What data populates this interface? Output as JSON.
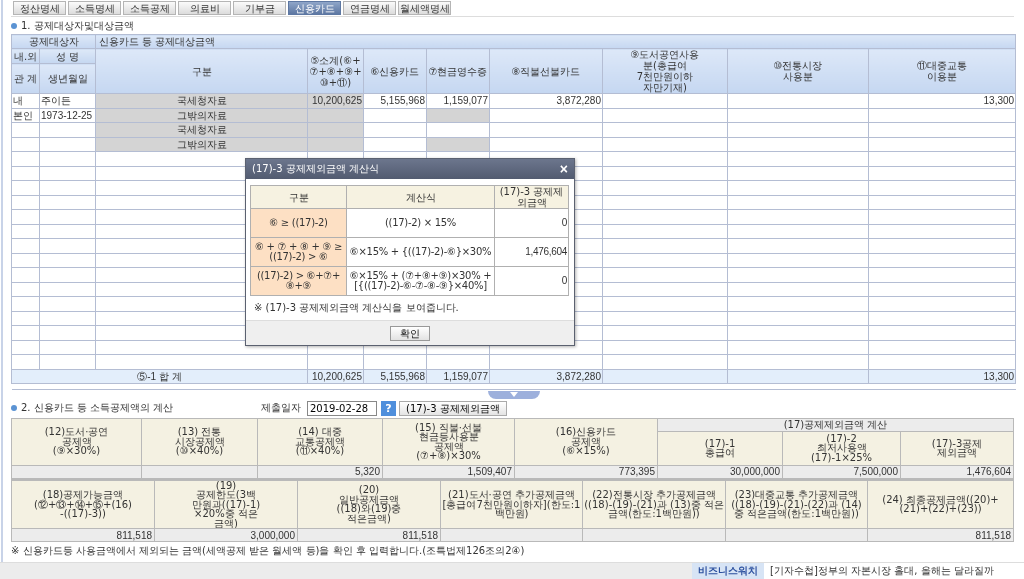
{
  "tabs": [
    {
      "label": "정산명세",
      "selected": false
    },
    {
      "label": "소득명세",
      "selected": false
    },
    {
      "label": "소득공제",
      "selected": false
    },
    {
      "label": "의료비",
      "selected": false
    },
    {
      "label": "기부금",
      "selected": false
    },
    {
      "label": "신용카드",
      "selected": true
    },
    {
      "label": "연금명세",
      "selected": false
    },
    {
      "label": "월세액명세",
      "selected": false
    }
  ],
  "section1": {
    "title": "1. 공제대상자및대상금액",
    "group_person": "공제대상자",
    "group_amounts": "신용카드 등 공제대상금액",
    "person_header_top": [
      "내.외",
      "성    명"
    ],
    "person_header_bottom": [
      "관 계",
      "생년월일"
    ],
    "columns": [
      "구분",
      "⑤소계(⑥+\n⑦+⑧+⑨+\n⑩+⑪)",
      "⑥신용카드",
      "⑦현금영수증",
      "⑧직불선불카드",
      "⑨도서공연사용\n분(총급여\n7천만원이하\n자만기재)",
      "⑩전통시장\n사용분",
      "⑪대중교통\n이용분"
    ],
    "rows": [
      {
        "kind": "nts",
        "person": [
          "내",
          "주이든"
        ],
        "category": "국세청자료",
        "values": {
          "subtotal": "10,200,625",
          "credit_card": "5,155,968",
          "cash_receipt": "1,159,077",
          "debit_card": "3,872,280",
          "public_transport": "13,300"
        }
      },
      {
        "kind": "other",
        "person": [
          "본인",
          "1973-12-25"
        ],
        "category": "그밖의자료"
      },
      {
        "kind": "nts",
        "category": "국세청자료"
      },
      {
        "kind": "other",
        "category": "그밖의자료"
      }
    ],
    "total": {
      "label": "⑤-1 합   계",
      "values": {
        "subtotal": "10,200,625",
        "credit_card": "5,155,968",
        "cash_receipt": "1,159,077",
        "debit_card": "3,872,280",
        "public_transport": "13,300"
      }
    }
  },
  "section2": {
    "title": "2. 신용카드 등 소득공제액의 계산",
    "date_label": "제출일자",
    "date_value": "2019-02-28",
    "help_button": "?",
    "exclusion_button": "(17)-3 공제제외금액",
    "headers_top": [
      "(12)도서·공연\n공제액\n(⑨×30%)",
      "(13) 전통\n시장공제액\n(⑩×40%)",
      "(14) 대중\n교통공제액\n(⑪×40%)",
      "(15) 직불·선불\n현금등사용분\n공제액\n(⑦+⑧)×30%",
      "(16)신용카드\n공제액\n(⑥×15%)"
    ],
    "exclusion_group": "(17)공제제외금액  계산",
    "exclusion_headers": [
      "(17)-1\n총급여",
      "(17)-2\n최저사용액\n(17)-1×25%",
      "(17)-3공제\n제외금액"
    ],
    "values_top": {
      "item_14": "5,320",
      "item_15": "1,509,407",
      "item_16": "773,395",
      "item_17_1": "30,000,000",
      "item_17_2": "7,500,000",
      "item_17_3": "1,476,604"
    },
    "headers_bottom": [
      "(18)공제가능금액(⑫+⑬+⑭+⑮+(16)\n-((17)-3))",
      "(19)\n공제한도(3백\n만원과((17)-1)\n×20%중 적은\n금액)",
      "(20)\n일반공제금액\n((18)와(19)중\n적은금액)",
      "(21)도서·공연  추가공제금액[총급여7천만원이하자](한도:1백만원)",
      "(22)전통시장  추가공제금액((18)-(19)-(21)과 (13)중 적은금액(한도:1백만원))",
      "(23)대중교통  추가공제금액((18)-(19)-(21)-(22)과 (14)중 적은금액(한도:1백만원))",
      "(24) 최종공제금액((20)+(21)+(22)+(23))"
    ],
    "values_bottom": {
      "item_18": "811,518",
      "item_19": "3,000,000",
      "item_20": "811,518",
      "item_24": "811,518"
    },
    "note": "※ 신용카드등 사용금액에서 제외되는 금액(세액공제 받은 월세액 등)을 확인 후 입력합니다.(조특법제126조의2④)"
  },
  "dialog": {
    "title": "(17)-3 공제제외금액 계산식",
    "close": "×",
    "headers": [
      "구분",
      "계산식",
      "(17)-3 공제제외금액"
    ],
    "rows": [
      {
        "condition": "⑥ ≥ ((17)-2)",
        "formula": "((17)-2) × 15%",
        "amount": "0"
      },
      {
        "condition": "⑥ + ⑦ + ⑧ + ⑨ ≥\n((17)-2) > ⑥",
        "formula": "⑥×15% + {((17)-2)-⑥}×30%",
        "amount": "1,476,604"
      },
      {
        "condition": "((17)-2) > ⑥+⑦+\n⑧+⑨",
        "formula": "⑥×15% + (⑦+⑧+⑨)×30% +\n[{((17)-2)-⑥-⑦-⑧-⑨}×40%]",
        "amount": "0"
      }
    ],
    "note": "※ (17)-3 공제제외금액 계산식을 보여줍니다.",
    "ok_button": "확인"
  },
  "news": {
    "source": "비즈니스워치",
    "headline": "[기자수첩]정부의 자본시장 홀대, 올해는 달라질까"
  }
}
